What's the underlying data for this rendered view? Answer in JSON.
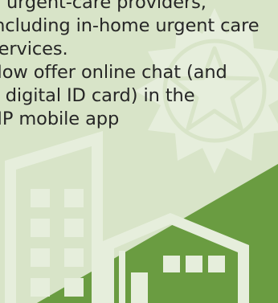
{
  "content": {
    "lines": [
      "urgent-care providers,",
      "including in-home urgent care",
      "services.",
      "Now offer online chat (and",
      "a digital ID card) in the",
      "HP mobile app"
    ]
  },
  "colors": {
    "background": "#d8e4c8",
    "illustration": "#e6eedc",
    "accent_green": "#6a9c41",
    "text": "#262626"
  },
  "icons": [
    "sun-badge-icon",
    "star-icon",
    "building-icon",
    "house-icon"
  ]
}
